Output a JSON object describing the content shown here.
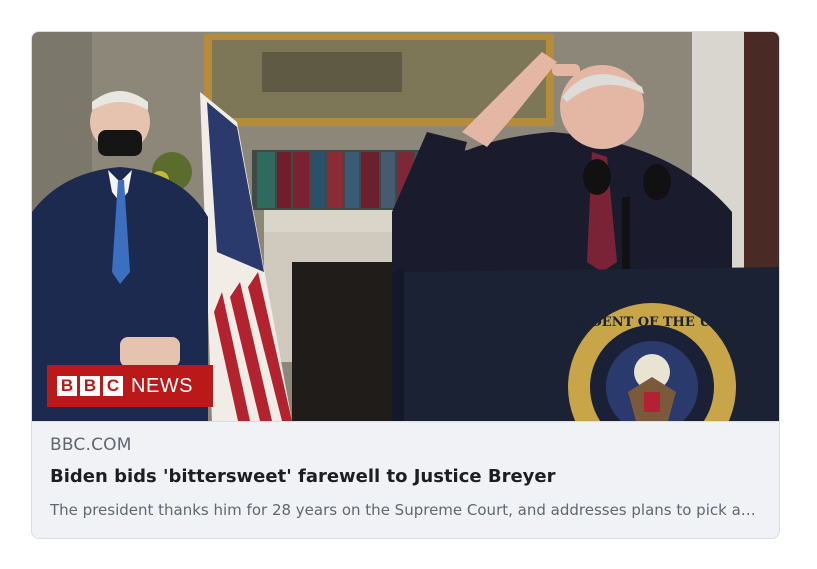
{
  "link_preview": {
    "domain": "BBC.COM",
    "title": "Biden bids 'bittersweet' farewell to Justice Breyer",
    "description": "The president thanks him for 28 years on the Supreme Court, and addresses plans to pick a new justice.",
    "image": {
      "alt": "Press photo at the White House with a salute at a presidential podium",
      "badge_letters": [
        "B",
        "B",
        "C"
      ],
      "badge_word": "NEWS",
      "seal_text": "PRESIDENT OF THE UNITED"
    }
  },
  "colors": {
    "card_background": "#f0f2f5",
    "border": "#dadde1",
    "domain_text": "#606770",
    "title_text": "#1c1e21",
    "bbc_red": "#bb1919"
  }
}
